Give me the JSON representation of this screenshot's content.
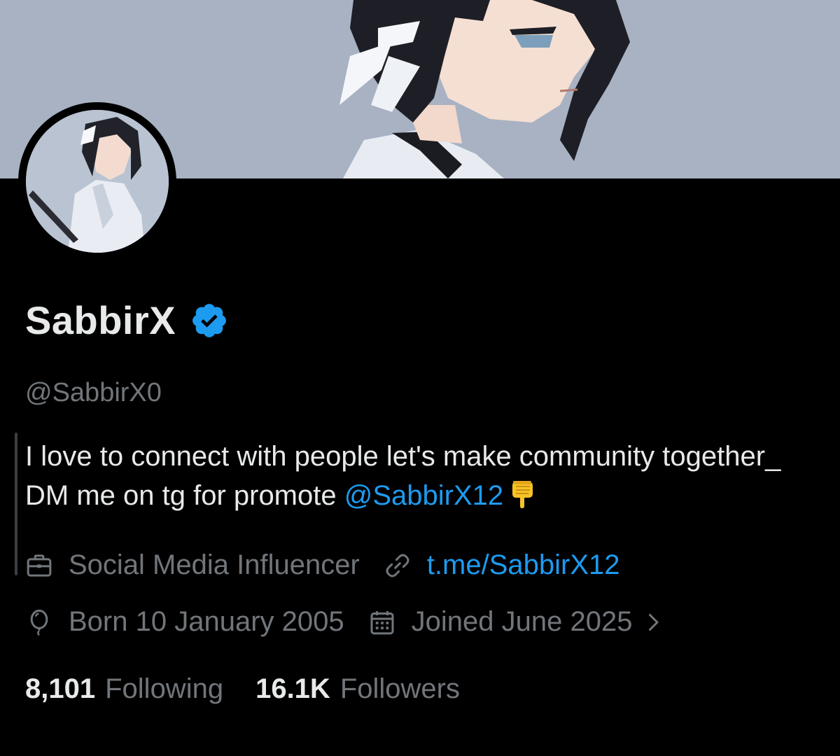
{
  "profile": {
    "display_name": "SabbirX",
    "handle": "@SabbirX0",
    "bio_text": "I love to connect with people let's make community together_ DM me on tg for promote ",
    "bio_mention": "@SabbirX12",
    "bio_emoji": "👇",
    "category": "Social Media Influencer",
    "website": "t.me/SabbirX12",
    "birthday": "Born 10 January 2005",
    "joined": "Joined June 2025"
  },
  "stats": {
    "following_count": "8,101",
    "following_label": "Following",
    "followers_count": "16.1K",
    "followers_label": "Followers"
  },
  "icons": {
    "verified": "verified-badge-icon",
    "category": "briefcase-icon",
    "website": "link-icon",
    "birthday": "balloon-icon",
    "joined": "calendar-icon",
    "more": "chevron-right-icon"
  },
  "colors": {
    "background": "#000000",
    "text_primary": "#e7e9ea",
    "text_secondary": "#71767b",
    "accent": "#1d9bf0",
    "banner": "#a9b3c4"
  }
}
